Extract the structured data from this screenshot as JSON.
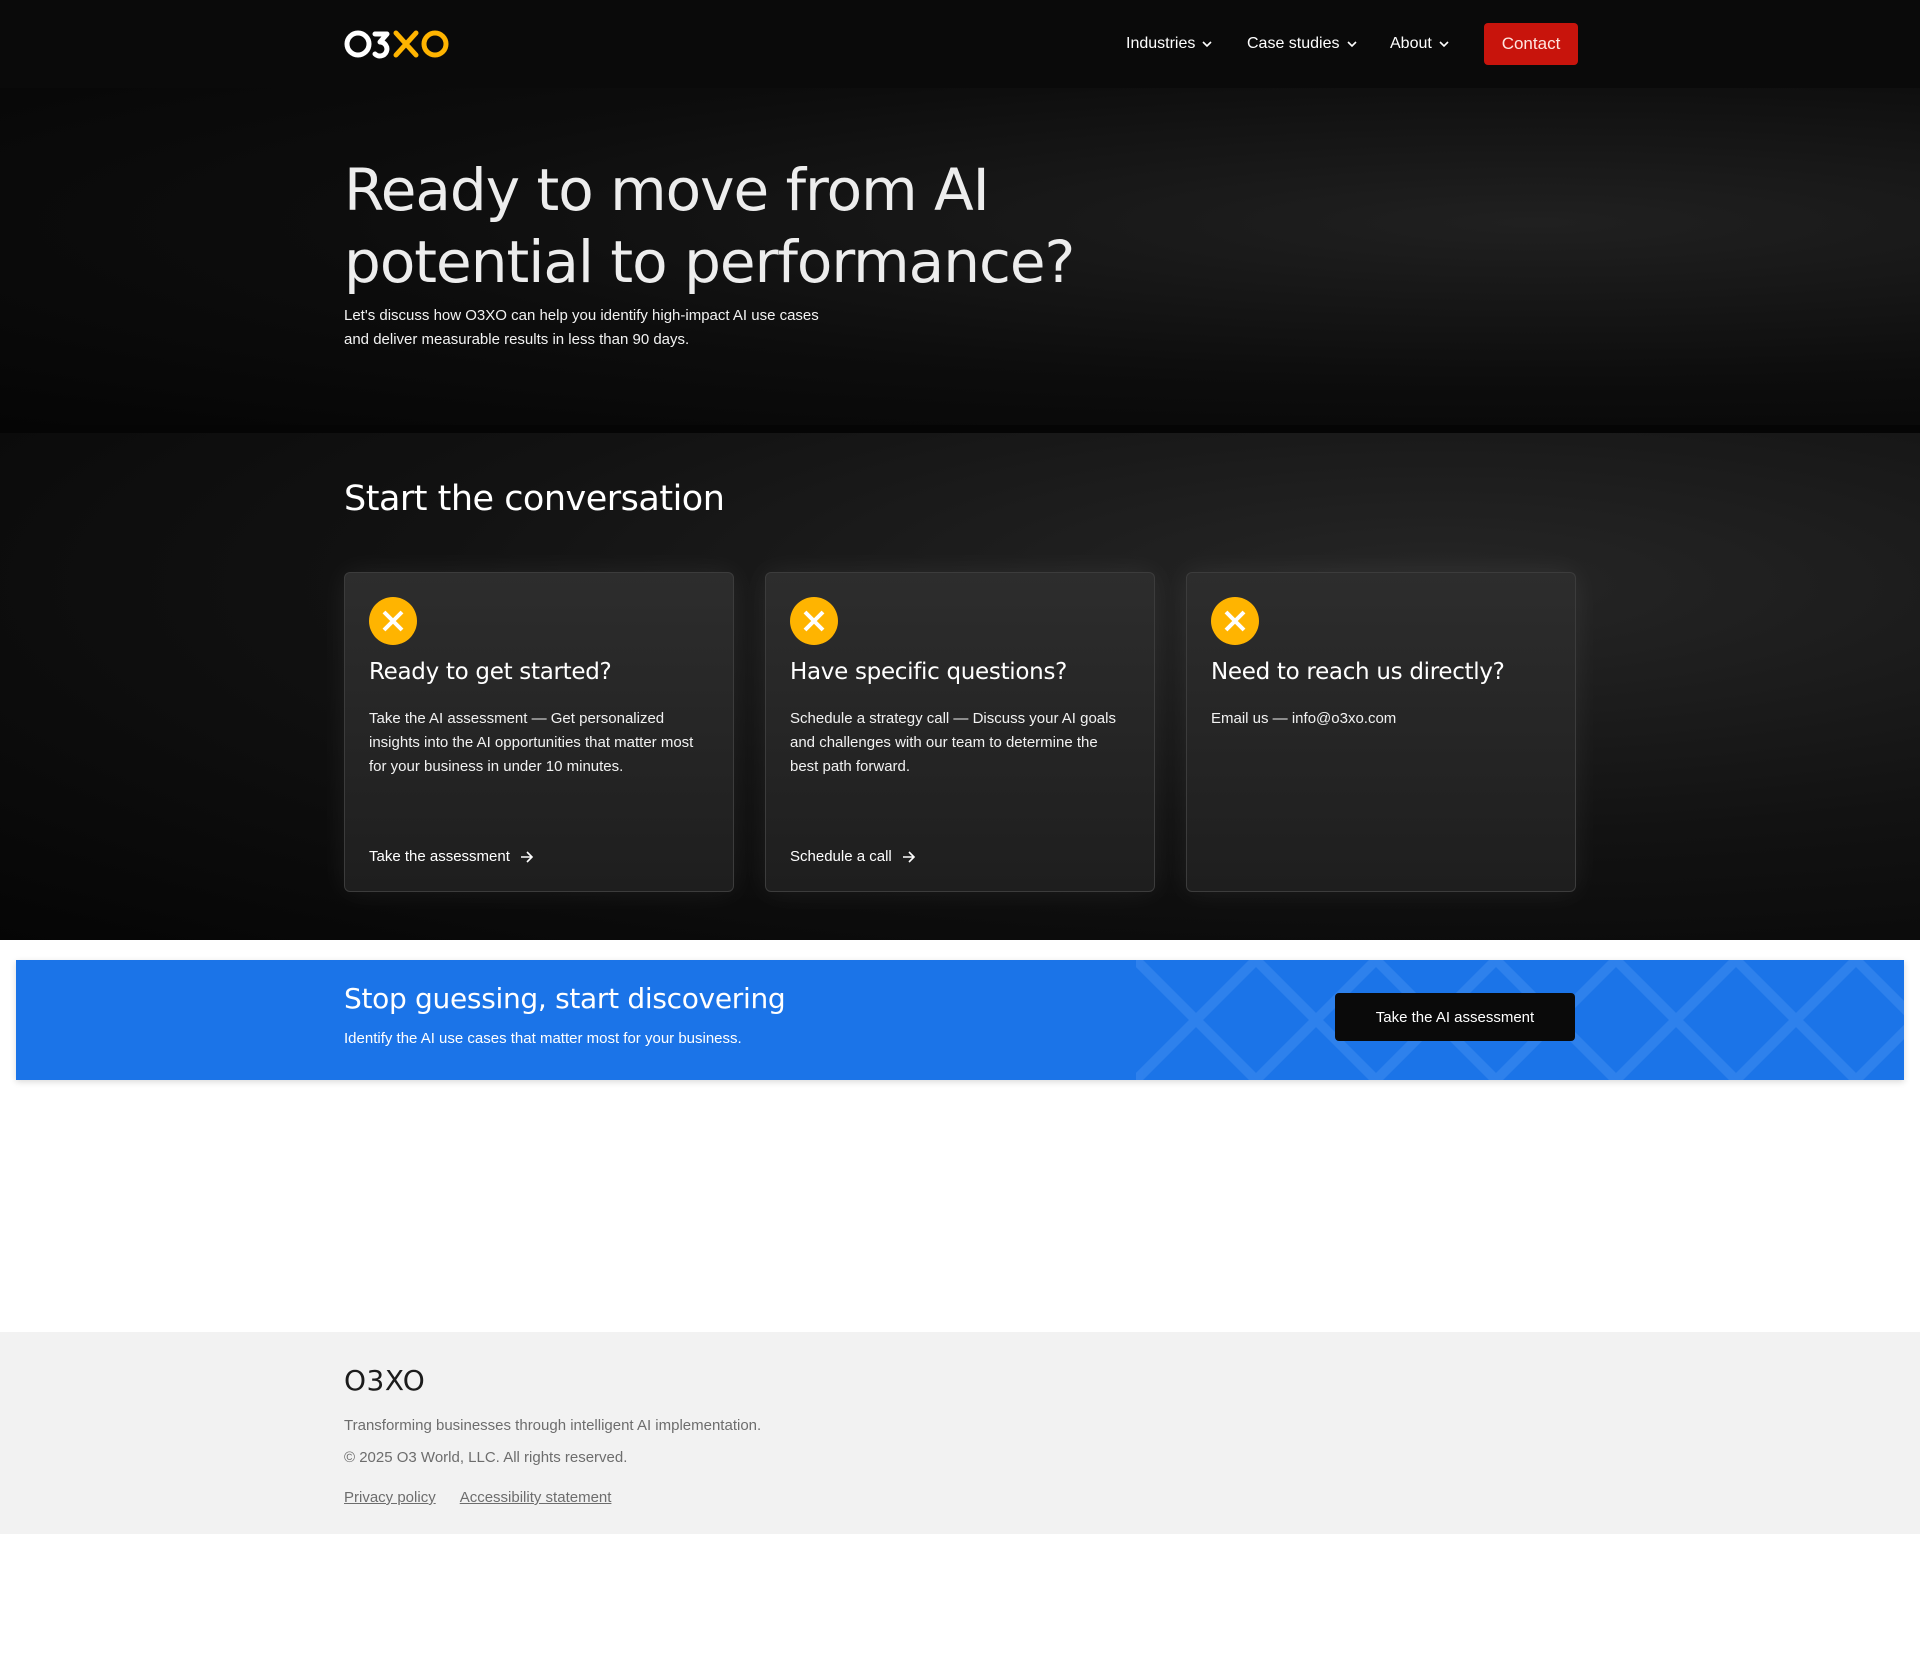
{
  "header": {
    "logo_text": "O3XO",
    "nav": [
      {
        "label": "Industries"
      },
      {
        "label": "Case studies"
      },
      {
        "label": "About"
      }
    ],
    "contact_label": "Contact"
  },
  "hero": {
    "title": "Ready to move from AI potential to performance?",
    "subtitle": "Let's discuss how O3XO can help you identify high-impact AI use cases and deliver measurable results in less than 90 days."
  },
  "conversation": {
    "heading": "Start the conversation",
    "cards": [
      {
        "title": "Ready to get started?",
        "description": "Take the AI assessment — Get personalized insights into the AI opportunities that matter most for your business in under 10 minutes.",
        "link": "Take the assessment"
      },
      {
        "title": "Have specific questions?",
        "description": "Schedule a strategy call — Discuss your AI goals and challenges with our team to determine the best path forward.",
        "link": "Schedule a call"
      },
      {
        "title": "Need to reach us directly?",
        "description": "Email us — info@o3xo.com",
        "link": ""
      }
    ]
  },
  "banner": {
    "title": "Stop guessing, start discovering",
    "subtitle": "Identify the AI use cases that matter most for your business.",
    "cta": "Take the AI assessment"
  },
  "footer": {
    "brand": "O3XO",
    "tagline": "Transforming businesses through intelligent AI implementation.",
    "copyright": "© 2025 O3 World, LLC. All rights reserved.",
    "links": [
      "Privacy policy",
      "Accessibility statement"
    ]
  },
  "colors": {
    "accent_yellow": "#ffb400",
    "contact_red": "#c8140c",
    "banner_blue": "#1b74e8",
    "dark_bg": "#0a0a0a"
  },
  "icons": [
    "logo-x-mark",
    "chevron-down-icon",
    "x-badge-icon",
    "arrow-right-icon"
  ]
}
